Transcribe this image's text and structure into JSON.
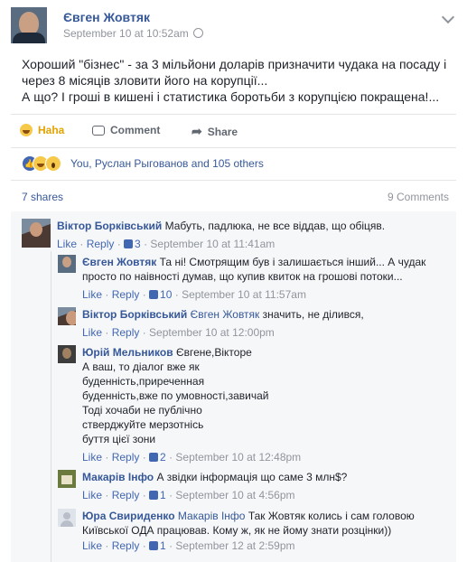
{
  "post": {
    "author": "Євген Жовтяк",
    "timestamp": "September 10 at 10:52am",
    "text_lines": [
      "Хороший \"бізнес\" - за 3 мільйони доларів призначити чудака на посаду і",
      "через 8 місяців зловити його на корупції...",
      "А що? І гроші в кишені і статистика боротьби з корупцією покращена!..."
    ]
  },
  "actions": {
    "haha": "Haha",
    "comment": "Comment",
    "share": "Share"
  },
  "reactions": {
    "summary": "You, Руслан Рыгованов and 105 others"
  },
  "stats": {
    "shares": "7 shares",
    "comments": "9 Comments"
  },
  "comments": [
    {
      "name": "Віктор Борківський",
      "tag": "",
      "lines": [
        "Мабуть, падлюка, не все віддав, що обіцяв."
      ],
      "like": "Like",
      "reply": "Reply",
      "likes": "3",
      "time": "September 10 at 11:41am"
    },
    {
      "name": "Євген Жовтяк",
      "tag": "",
      "lines": [
        "Та ні! Смотрящим був і залишається інший... А чудак",
        "просто по наівності думав, що купив квиток на грошові потоки..."
      ],
      "like": "Like",
      "reply": "Reply",
      "likes": "10",
      "time": "September 10 at 11:57am"
    },
    {
      "name": "Віктор Борківський",
      "tag": "Євген Жовтяк",
      "lines": [
        "значить, не ділився,"
      ],
      "like": "Like",
      "reply": "Reply",
      "likes": "",
      "time": "September 10 at 12:00pm"
    },
    {
      "name": "Юрій Мельников",
      "tag": "",
      "lines": [
        "Євгене,Вікторе",
        "А ваш, то діалог вже як",
        "буденність,приреченная",
        "буденність,вже по умовності,завичай",
        "Тоді хочаби не публічно",
        "стверджуйте мерзотнісь",
        "буття цієї зони"
      ],
      "like": "Like",
      "reply": "Reply",
      "likes": "2",
      "time": "September 10 at 12:48pm"
    },
    {
      "name": "Макарів Інфо",
      "tag": "",
      "lines": [
        "А звідки інформація що саме 3 млн$?"
      ],
      "like": "Like",
      "reply": "Reply",
      "likes": "1",
      "time": "September 10 at 4:56pm"
    },
    {
      "name": "Юра Свириденко",
      "tag": "Макарів Інфо",
      "lines": [
        "Так Жовтяк колись і сам головою",
        "Київської ОДА працював. Кому ж, як не йому знати розцінки))"
      ],
      "like": "Like",
      "reply": "Reply",
      "likes": "1",
      "time": "September 12 at 2:59pm"
    }
  ]
}
